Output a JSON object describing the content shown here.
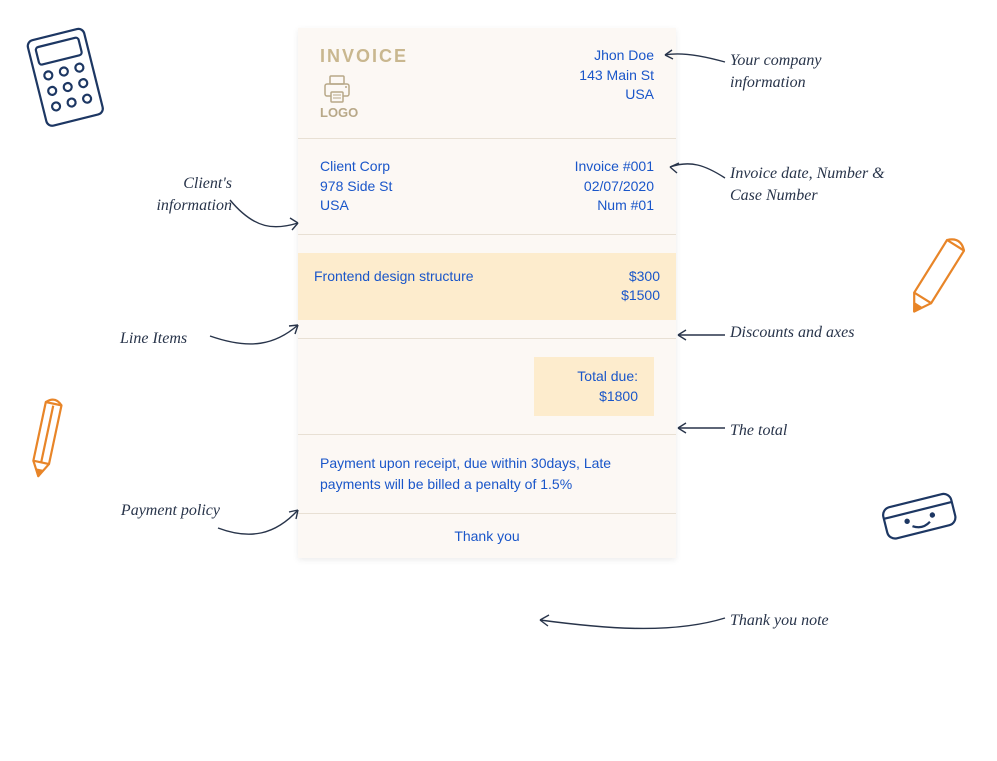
{
  "invoice": {
    "title": "INVOICE",
    "logo_label": "LOGO",
    "company": {
      "name": "Jhon Doe",
      "street": "143 Main St",
      "country": "USA"
    },
    "client": {
      "name": "Client Corp",
      "street": "978 Side St",
      "country": "USA"
    },
    "meta": {
      "number": "Invoice #001",
      "date": "02/07/2020",
      "case": "Num #01"
    },
    "line_items": [
      {
        "description": "Frontend design structure",
        "amounts": [
          "$300",
          "$1500"
        ]
      }
    ],
    "total": {
      "label": "Total due:",
      "value": "$1800"
    },
    "payment_policy": "Payment upon receipt, due within 30days, Late payments  will be billed a penalty of 1.5%",
    "thank_you": "Thank you"
  },
  "annotations": {
    "company_info": "Your company information",
    "client_info": "Client's information",
    "invoice_meta": "Invoice date, Number & Case Number",
    "line_items": "Line Items",
    "discounts": "Discounts and axes",
    "total": "The total",
    "payment_policy": "Payment policy",
    "thank_you": "Thank you note"
  },
  "colors": {
    "invoice_accent": "#1a56c9",
    "highlight_bg": "#fdeccd",
    "title_tan": "#c9b78f",
    "annotation_text": "#28344a",
    "doodle_navy": "#1d3763",
    "doodle_orange": "#e88528"
  }
}
